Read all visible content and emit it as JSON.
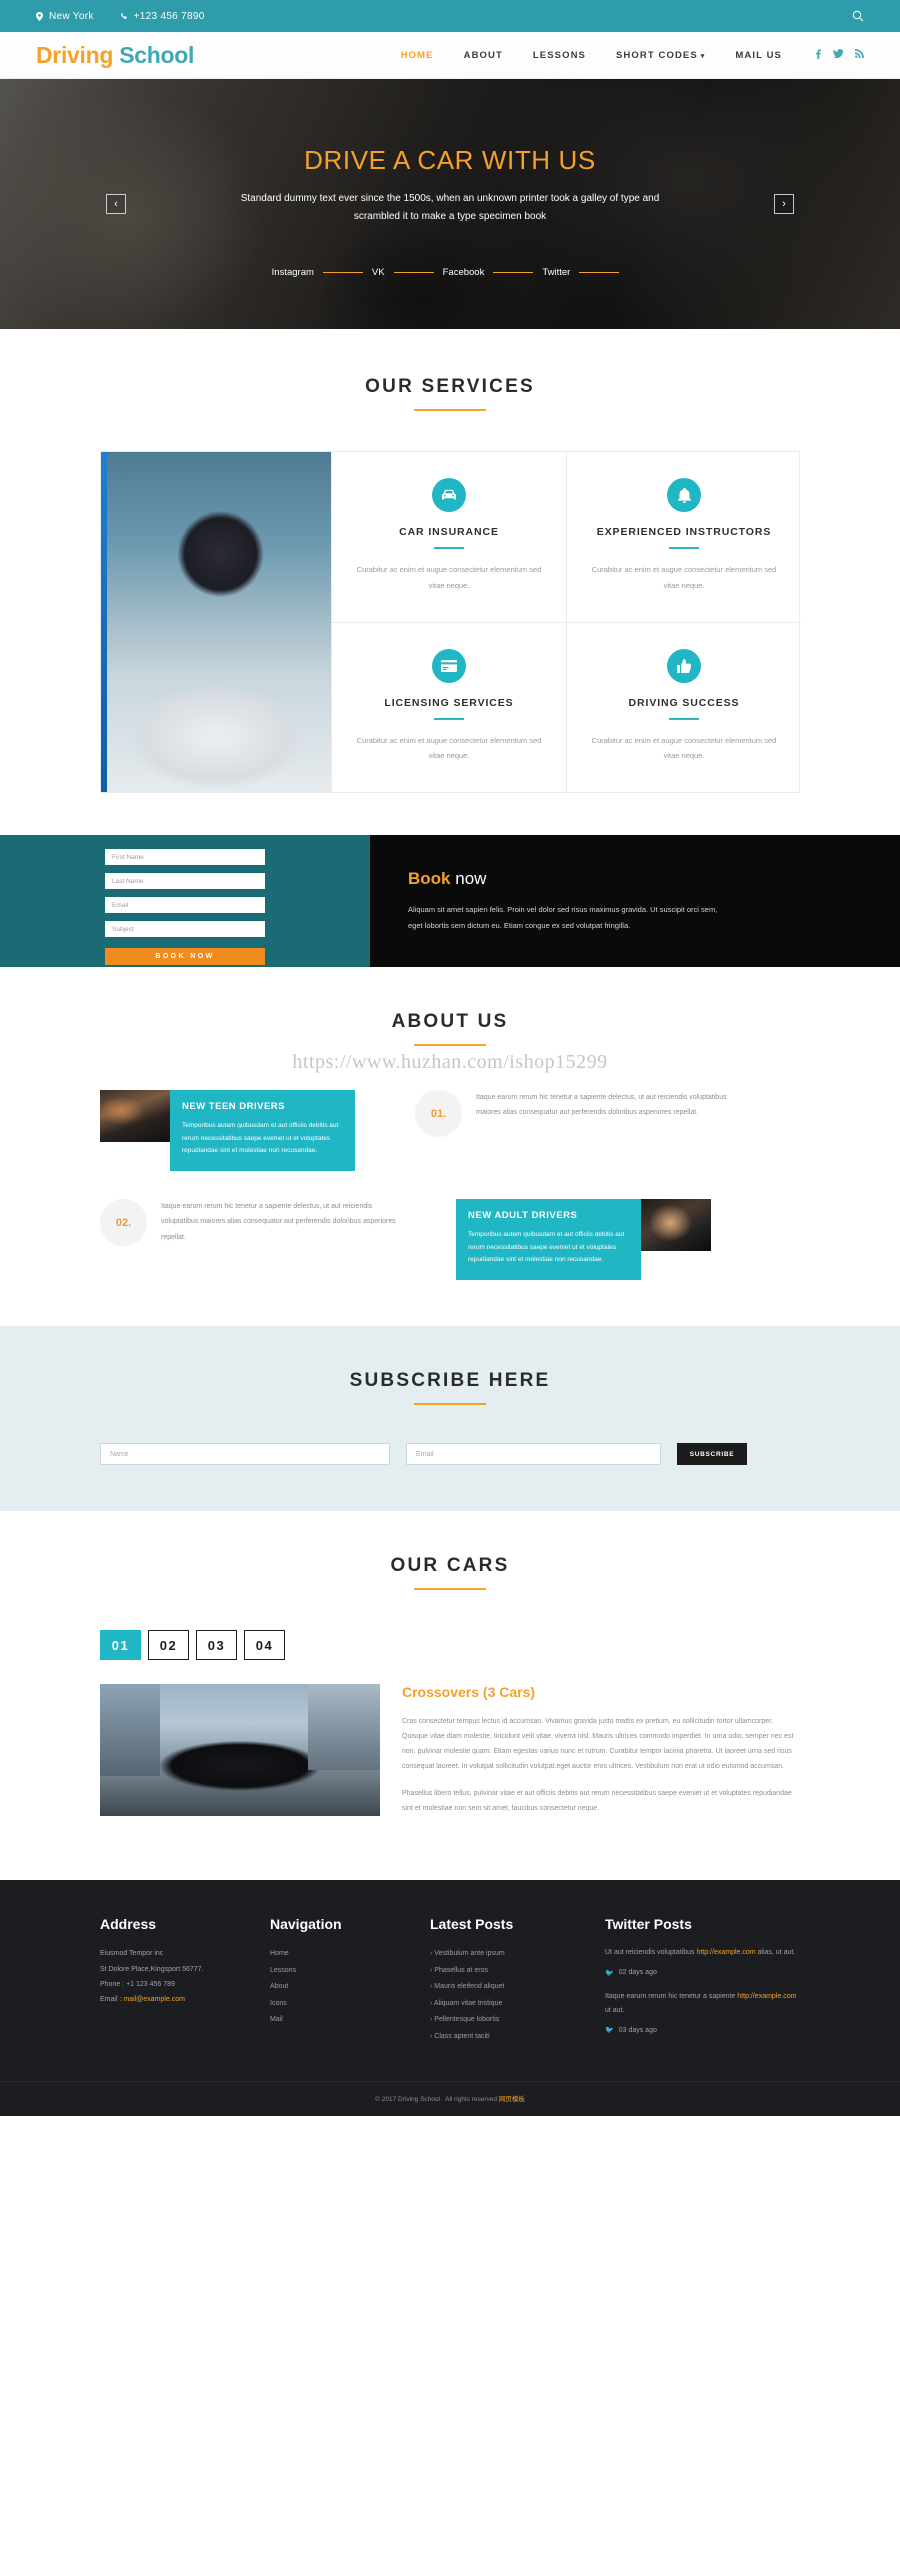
{
  "topbar": {
    "location": "New York",
    "phone": "+123 456 7890",
    "search_icon": "search-icon"
  },
  "header": {
    "logo_part1": "Driving",
    "logo_part2": "School",
    "nav": [
      {
        "label": "HOME",
        "active": true
      },
      {
        "label": "ABOUT",
        "active": false
      },
      {
        "label": "LESSONS",
        "active": false
      },
      {
        "label": "SHORT CODES",
        "active": false,
        "caret": "▾"
      },
      {
        "label": "MAIL US",
        "active": false
      }
    ],
    "social": [
      "facebook-icon",
      "twitter-icon",
      "rss-icon"
    ],
    "social_glyphs": [
      "f",
      "t",
      "r"
    ]
  },
  "hero": {
    "title": "DRIVE A CAR WITH US",
    "subtitle": "Standard dummy text ever since the 1500s, when an unknown printer took a galley of type and scrambled it to make a type specimen book",
    "social": [
      "Instagram",
      "VK",
      "Facebook",
      "Twitter"
    ],
    "prev": "‹",
    "next": "›"
  },
  "services": {
    "title": "OUR SERVICES",
    "items": [
      {
        "icon": "car-icon",
        "title": "CAR INSURANCE",
        "text": "Curabitur ac enim et augue consectetur elementum sed vitae neque."
      },
      {
        "icon": "bell-icon",
        "title": "EXPERIENCED INSTRUCTORS",
        "text": "Curabitur ac enim et augue consectetur elementum sed vitae neque."
      },
      {
        "icon": "card-icon",
        "title": "LICENSING SERVICES",
        "text": "Curabitur ac enim et augue consectetur elementum sed vitae neque."
      },
      {
        "icon": "thumbs-up-icon",
        "title": "DRIVING SUCCESS",
        "text": "Curabitur ac enim et augue consectetur elementum sed vitae neque."
      }
    ]
  },
  "book": {
    "fields": [
      {
        "name": "first-name",
        "placeholder": "First Name",
        "value": ""
      },
      {
        "name": "last-name",
        "placeholder": "Last Name",
        "value": ""
      },
      {
        "name": "email",
        "placeholder": "Email",
        "value": ""
      },
      {
        "name": "subject",
        "placeholder": "Subject",
        "value": ""
      }
    ],
    "button": "BOOK NOW",
    "heading_1": "Book",
    "heading_2": "now",
    "text": "Aliquam sit amet sapien felis. Proin vel dolor sed risus maximus gravida. Ut suscipit orci sem, eget lobortis sem dictum eu. Etiam congue ex sed volutpat fringilla."
  },
  "about": {
    "title": "ABOUT US",
    "watermark": "https://www.huzhan.com/ishop15299",
    "cards": [
      {
        "heading": "NEW TEEN DRIVERS",
        "text": "Temporibus autem quibusdam et aut officiis debitis aut rerum necessitatibus saepe eveniet ut et voluptates repudiandae sint et molestiae non recusandae."
      },
      {
        "heading": "NEW ADULT DRIVERS",
        "text": "Temporibus autem quibusdam et aut officiis debitis aut rerum necessitatibus saepe eveniet ut et voluptates repudiandae sint et molestiae non recusandae."
      }
    ],
    "numbers": [
      {
        "num": "01.",
        "text": "Itaque earum rerum hic tenetur a sapiente delectus, ut aut reiciendis voluptatibus maiores alias consequatur aut perferendis doloribus asperiores repellat."
      },
      {
        "num": "02.",
        "text": "Itaque earum rerum hic tenetur a sapiente delectus, ut aut reiciendis voluptatibus maiores alias consequatur aut perferendis doloribus asperiores repellat."
      }
    ]
  },
  "subscribe": {
    "title": "SUBSCRIBE HERE",
    "name_placeholder": "Name",
    "email_placeholder": "Email",
    "button": "SUBSCRIBE"
  },
  "cars": {
    "title": "OUR CARS",
    "tabs": [
      {
        "label": "01",
        "active": true
      },
      {
        "label": "02",
        "active": false
      },
      {
        "label": "03",
        "active": false
      },
      {
        "label": "04",
        "active": false
      }
    ],
    "heading": "Crossovers (3 Cars)",
    "paragraph_1": "Cras consectetur tempus lectus id accumsan. Vivamus gravida justo mattis ex pretium, eu sollicitudin tortor ullamcorper. Quisque vitae diam molestie, tincidunt velit vitae, viverra nisl. Mauris ultrices commodo imperdiet. In urna odio, semper nec est non, pulvinar molestie quam. Etiam egestas varius nunc et rutrum. Curabitur tempor lacinia pharetra. Ut laoreet urna sed risus consequat laoreet. In volutpat sollicitudin volutpat.eget auctor eros ultrices. Vestibulum non erat ut odio euismod accumsan.",
    "paragraph_2": "Phasellus libero tellus, pulvinar vitae et aut officiis debitis aut rerum necessitatibus saepe eveniet ut et voluptates repudiandae sint et molestiae non sem sit amet, faucibus consectetur neque."
  },
  "footer": {
    "address": {
      "title": "Address",
      "company": "Eiusmod Tempor inc",
      "street": "St Dolore Place,Kingsport 56777.",
      "phone": "Phone : +1 123 456 789",
      "email_label": "Email : ",
      "email": "mail@example.com"
    },
    "navigation": {
      "title": "Navigation",
      "items": [
        "Home",
        "Lessons",
        "About",
        "Icons",
        "Mail"
      ]
    },
    "latest_posts": {
      "title": "Latest Posts",
      "items": [
        "Vestibulum ante ipsum",
        "Phasellus at eros",
        "Mauris eleifend aliquet",
        "Aliquam vitae tristique",
        "Pellentesque lobortis",
        "Class aptent taciti"
      ]
    },
    "twitter": {
      "title": "Twitter Posts",
      "posts": [
        {
          "pre": "Ut aut reiciendis voluptatibus ",
          "link": "http://example.com",
          "post": " alias, ut aut.",
          "time": "02 days ago"
        },
        {
          "pre": "Itaque earum rerum hic tenetur a sapiente ",
          "link": "http://example.com",
          "post": " ut aut.",
          "time": "03 days ago"
        }
      ]
    },
    "copyright_pre": "© 2017 Driving School . All rights reserved ",
    "copyright_link": "网页模板"
  },
  "colors": {
    "teal": "#20b6c4",
    "topbar_teal": "#2f9cab",
    "orange": "#f5a12a",
    "dark": "#1c1d21"
  }
}
